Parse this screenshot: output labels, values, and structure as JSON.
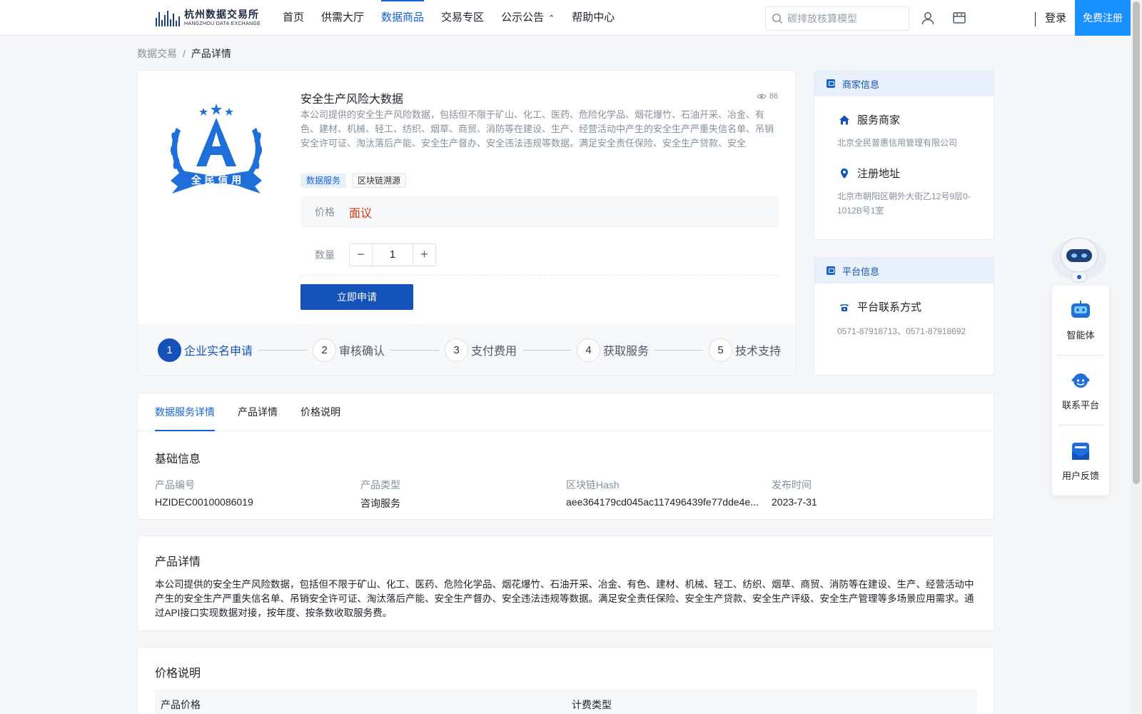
{
  "header": {
    "logo_cn": "杭州数据交易所",
    "logo_en": "HANGZHOU DATA EXCHANGE",
    "nav": [
      "首页",
      "供需大厅",
      "数据商品",
      "交易专区",
      "公示公告",
      "帮助中心"
    ],
    "active_nav": "数据商品",
    "search_placeholder": "碳排放核算模型",
    "login": "登录",
    "register": "免费注册"
  },
  "breadcrumb": {
    "parent": "数据交易",
    "separator": "/",
    "current": "产品详情"
  },
  "product": {
    "logo_text": "全民信用",
    "title": "安全生产风险大数据",
    "views": "86",
    "description": "本公司提供的安全生产风险数据，包括但不限于矿山、化工、医药、危险化学品、烟花爆竹、石油开采、冶金、有色、建材、机械、轻工、纺织、烟草、商贸、消防等在建设、生产、经营活动中产生的安全生产严重失信名单、吊销安全许可证、淘汰落后产能、安全生产督办、安全违法违规等数据。满足安全责任保险、安全生产贷款、安全",
    "tags": [
      "数据服务",
      "区块链溯源"
    ],
    "price_label": "价格",
    "price_value": "面议",
    "qty_label": "数量",
    "qty_value": "1",
    "apply_button": "立即申请"
  },
  "steps": [
    {
      "num": "1",
      "label": "企业实名申请"
    },
    {
      "num": "2",
      "label": "审核确认"
    },
    {
      "num": "3",
      "label": "支付费用"
    },
    {
      "num": "4",
      "label": "获取服务"
    },
    {
      "num": "5",
      "label": "技术支持"
    }
  ],
  "merchant": {
    "head": "商家信息",
    "service_title": "服务商家",
    "service_value": "北京全民普惠信用管理有限公司",
    "address_title": "注册地址",
    "address_value": "北京市朝阳区朝外大街乙12号9层0-1012B号1室"
  },
  "platform": {
    "head": "平台信息",
    "contact_title": "平台联系方式",
    "contact_value": "0571-87918713、0571-87918692"
  },
  "float_widgets": [
    "智能体",
    "联系平台",
    "用户反馈"
  ],
  "tabs": [
    "数据服务详情",
    "产品详情",
    "价格说明"
  ],
  "basic_info": {
    "title": "基础信息",
    "fields": [
      {
        "label": "产品编号",
        "value": "HZIDEC00100086019"
      },
      {
        "label": "产品类型",
        "value": "咨询服务"
      },
      {
        "label": "区块链Hash",
        "value": "aee364179cd045ac117496439fe77dde4e..."
      },
      {
        "label": "发布时间",
        "value": "2023-7-31"
      }
    ]
  },
  "detail": {
    "title": "产品详情",
    "text": "本公司提供的安全生产风险数据，包括但不限于矿山、化工、医药、危险化学品、烟花爆竹、石油开采、冶金、有色、建材、机械、轻工、纺织、烟草、商贸、消防等在建设、生产、经营活动中产生的安全生产严重失信名单、吊销安全许可证、淘汰落后产能、安全生产督办、安全违法违规等数据。满足安全责任保险、安全生产贷款、安全生产评级、安全生产管理等多场景应用需求。通过API接口实现数据对接，按年度、按条数收取服务费。"
  },
  "price_section": {
    "title": "价格说明",
    "columns": [
      "产品价格",
      "计费类型"
    ]
  },
  "colors": {
    "primary": "#1664d4",
    "button": "#1452b8",
    "register": "#1890ff",
    "price": "#d4380d"
  }
}
